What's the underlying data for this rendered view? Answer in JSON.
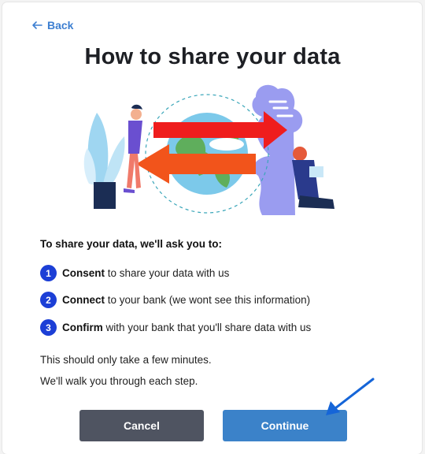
{
  "nav": {
    "back_label": "Back",
    "back_icon": "arrow-left-icon"
  },
  "page": {
    "title": "How to share your data"
  },
  "intro": "To share your data, we'll ask you to:",
  "steps": [
    {
      "num": "1",
      "bold": "Consent",
      "rest": " to share your data with us"
    },
    {
      "num": "2",
      "bold": "Connect",
      "rest": " to your bank (we wont see this information)"
    },
    {
      "num": "3",
      "bold": "Confirm",
      "rest": " with your bank that you'll share data with us"
    }
  ],
  "notes": {
    "time": "This should only take a few minutes.",
    "walk": "We'll walk you through each step."
  },
  "buttons": {
    "cancel": "Cancel",
    "continue": "Continue"
  },
  "colors": {
    "accent": "#3d7fd1",
    "step_badge": "#1c3fd6",
    "cancel_bg": "#4f5461",
    "continue_bg": "#3b82c9",
    "annotation_arrow": "#1565d8"
  }
}
